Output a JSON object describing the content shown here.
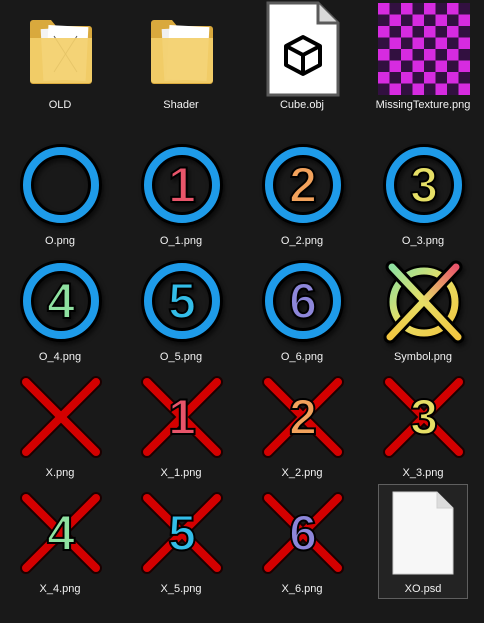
{
  "window": {
    "background": "#191919"
  },
  "colors": {
    "ring_blue": "#1e9be9",
    "cross_red": "#d40000",
    "digit_1": "#e8556a",
    "digit_2": "#f2a25c",
    "digit_3": "#e6df66",
    "digit_4": "#8ee0a0",
    "digit_5": "#33bde8",
    "digit_6": "#8d86d9",
    "missing_magenta": "#d62be0",
    "missing_dark": "#321040"
  },
  "files": [
    {
      "name": "OLD",
      "kind": "folder-icon"
    },
    {
      "name": "Shader",
      "kind": "folder-icon"
    },
    {
      "name": "Cube.obj",
      "kind": "3d-object-icon"
    },
    {
      "name": "MissingTexture.png",
      "kind": "checkerboard-thumbnail"
    },
    {
      "name": "O.png",
      "kind": "ring-thumbnail"
    },
    {
      "name": "O_1.png",
      "kind": "ring-thumbnail",
      "digit": "1"
    },
    {
      "name": "O_2.png",
      "kind": "ring-thumbnail",
      "digit": "2"
    },
    {
      "name": "O_3.png",
      "kind": "ring-thumbnail",
      "digit": "3"
    },
    {
      "name": "O_4.png",
      "kind": "ring-thumbnail",
      "digit": "4"
    },
    {
      "name": "O_5.png",
      "kind": "ring-thumbnail",
      "digit": "5"
    },
    {
      "name": "O_6.png",
      "kind": "ring-thumbnail",
      "digit": "6"
    },
    {
      "name": "Symbol.png",
      "kind": "symbol-thumbnail"
    },
    {
      "name": "X.png",
      "kind": "cross-thumbnail"
    },
    {
      "name": "X_1.png",
      "kind": "cross-thumbnail",
      "digit": "1"
    },
    {
      "name": "X_2.png",
      "kind": "cross-thumbnail",
      "digit": "2"
    },
    {
      "name": "X_3.png",
      "kind": "cross-thumbnail",
      "digit": "3"
    },
    {
      "name": "X_4.png",
      "kind": "cross-thumbnail",
      "digit": "4"
    },
    {
      "name": "X_5.png",
      "kind": "cross-thumbnail",
      "digit": "5"
    },
    {
      "name": "X_6.png",
      "kind": "cross-thumbnail",
      "digit": "6"
    },
    {
      "name": "XO.psd",
      "kind": "blank-file-icon",
      "selected": true
    }
  ]
}
